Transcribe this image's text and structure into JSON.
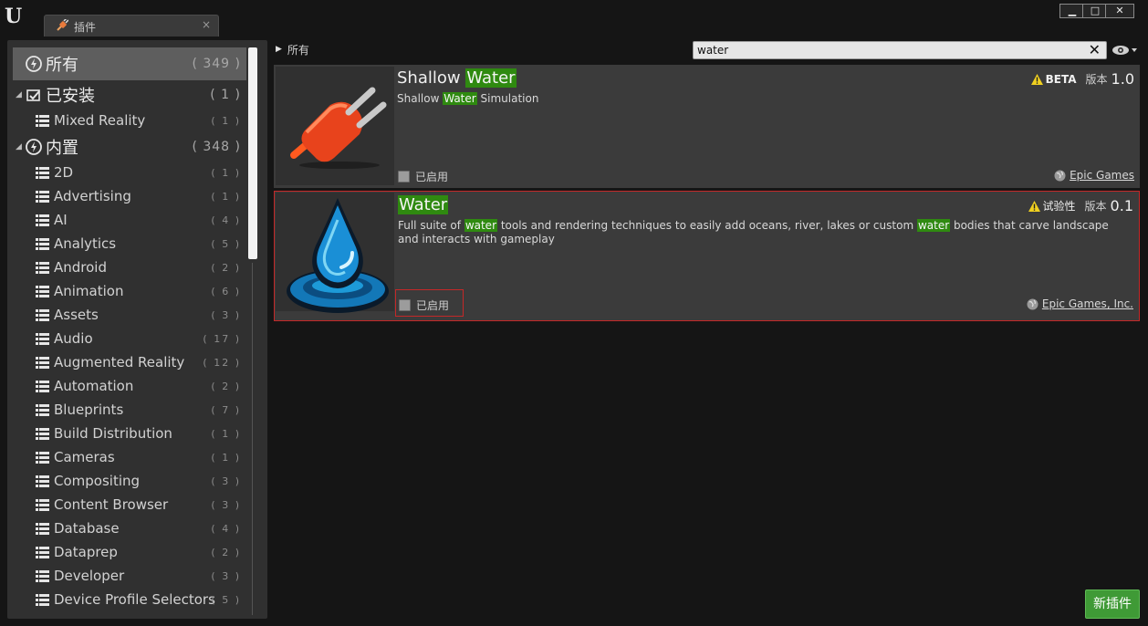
{
  "window": {
    "tab_label": "插件",
    "tab_close": "×",
    "controls": {
      "minimize": "▁",
      "maximize": "□",
      "close": "✕"
    }
  },
  "logo": "U",
  "sidebar": {
    "top": {
      "label": "所有",
      "count": "( 349 )"
    },
    "groups": [
      {
        "label": "已安装",
        "count": "( 1 )",
        "items": [
          {
            "label": "Mixed Reality",
            "count": "( 1 )"
          }
        ]
      },
      {
        "label": "内置",
        "count": "( 348 )",
        "items": [
          {
            "label": "2D",
            "count": "( 1 )"
          },
          {
            "label": "Advertising",
            "count": "( 1 )"
          },
          {
            "label": "AI",
            "count": "( 4 )"
          },
          {
            "label": "Analytics",
            "count": "( 5 )"
          },
          {
            "label": "Android",
            "count": "( 2 )"
          },
          {
            "label": "Animation",
            "count": "( 6 )"
          },
          {
            "label": "Assets",
            "count": "( 3 )"
          },
          {
            "label": "Audio",
            "count": "( 17 )"
          },
          {
            "label": "Augmented Reality",
            "count": "( 12 )"
          },
          {
            "label": "Automation",
            "count": "( 2 )"
          },
          {
            "label": "Blueprints",
            "count": "( 7 )"
          },
          {
            "label": "Build Distribution",
            "count": "( 1 )"
          },
          {
            "label": "Cameras",
            "count": "( 1 )"
          },
          {
            "label": "Compositing",
            "count": "( 3 )"
          },
          {
            "label": "Content Browser",
            "count": "( 3 )"
          },
          {
            "label": "Database",
            "count": "( 4 )"
          },
          {
            "label": "Dataprep",
            "count": "( 2 )"
          },
          {
            "label": "Developer",
            "count": "( 3 )"
          },
          {
            "label": "Device Profile Selectors",
            "count": "( 5 )"
          }
        ]
      }
    ]
  },
  "breadcrumb": {
    "label": "所有"
  },
  "search": {
    "value": "water",
    "clear": "✕"
  },
  "plugins": [
    {
      "title_pre": "Shallow ",
      "title_hl": "Water",
      "desc_pre": "Shallow ",
      "desc_hl": "Water",
      "desc_post": " Simulation",
      "badge": "BETA",
      "version_label": "版本",
      "version": "1.0",
      "enabled_label": "已启用",
      "creator": "Epic Games"
    },
    {
      "title_hl": "Water",
      "desc_1": "Full suite of ",
      "desc_hl_1": "water",
      "desc_2": " tools and rendering techniques to easily add oceans, river, lakes or custom ",
      "desc_hl_2": "water",
      "desc_3": " bodies that carve landscape and interacts with gameplay",
      "badge": "试验性",
      "version_label": "版本",
      "version": "0.1",
      "enabled_label": "已启用",
      "creator": "Epic Games, Inc."
    }
  ],
  "new_plugin_button": "新插件",
  "colors": {
    "highlight": "#2f8a10",
    "accent_button": "#3f9a36",
    "selection_border": "#c42828",
    "plug_orange": "#e8431c",
    "water_blue": "#1fa3e0"
  },
  "icons": [
    "plugin-category-icon",
    "list-icon",
    "warning-icon",
    "globe-icon",
    "eye-icon",
    "plug-icon",
    "water-drop-icon"
  ]
}
